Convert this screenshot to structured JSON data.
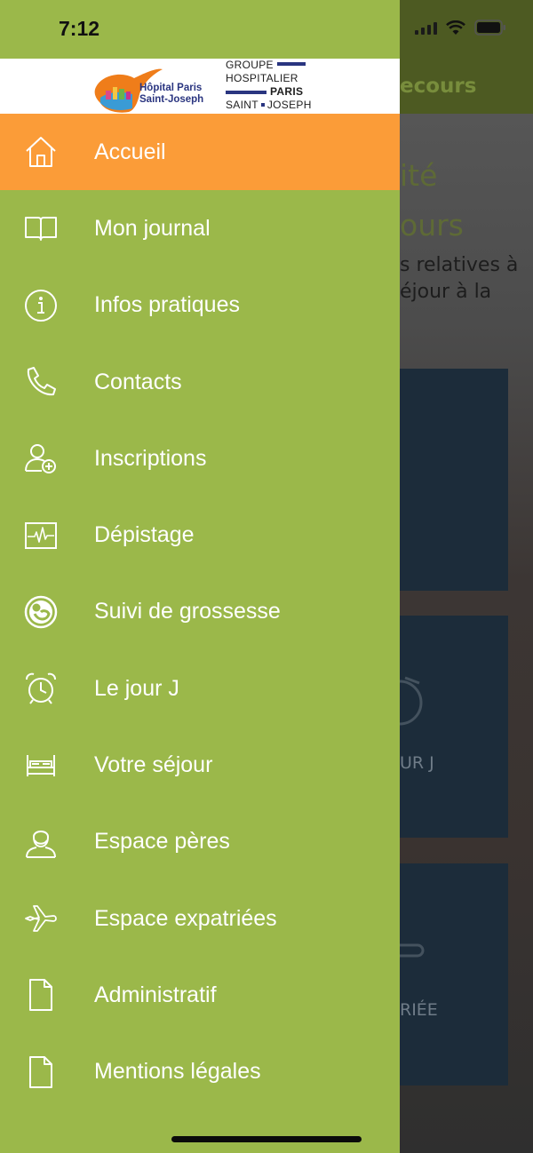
{
  "status_bar": {
    "time": "7:12"
  },
  "background": {
    "header_title": "ecours",
    "heading_lines": [
      "ité",
      "ours"
    ],
    "text_lines": [
      "s relatives à",
      "éjour à la"
    ],
    "cards": [
      "",
      "UR J",
      "RIÉE"
    ]
  },
  "logo": {
    "hospital_line1": "Hôpital Paris",
    "hospital_line2": "Saint-Joseph",
    "group_line1": "GROUPE",
    "group_line2": "HOSPITALIER",
    "group_line3": "PARIS",
    "group_line4": "SAINT",
    "group_line5": "JOSEPH"
  },
  "menu": {
    "items": [
      {
        "label": "Accueil",
        "icon": "home-icon",
        "active": true
      },
      {
        "label": "Mon journal",
        "icon": "book-icon"
      },
      {
        "label": "Infos pratiques",
        "icon": "info-icon"
      },
      {
        "label": "Contacts",
        "icon": "phone-icon"
      },
      {
        "label": "Inscriptions",
        "icon": "user-add-icon"
      },
      {
        "label": "Dépistage",
        "icon": "pulse-icon"
      },
      {
        "label": "Suivi de grossesse",
        "icon": "baby-icon"
      },
      {
        "label": "Le jour J",
        "icon": "alarm-clock-icon"
      },
      {
        "label": "Votre séjour",
        "icon": "bed-icon"
      },
      {
        "label": "Espace pères",
        "icon": "man-icon"
      },
      {
        "label": "Espace expatriées",
        "icon": "airplane-icon"
      },
      {
        "label": "Administratif",
        "icon": "document-icon"
      },
      {
        "label": "Mentions légales",
        "icon": "document-icon"
      }
    ]
  },
  "colors": {
    "drawer": "#9bb84a",
    "active": "#fb9c38"
  }
}
